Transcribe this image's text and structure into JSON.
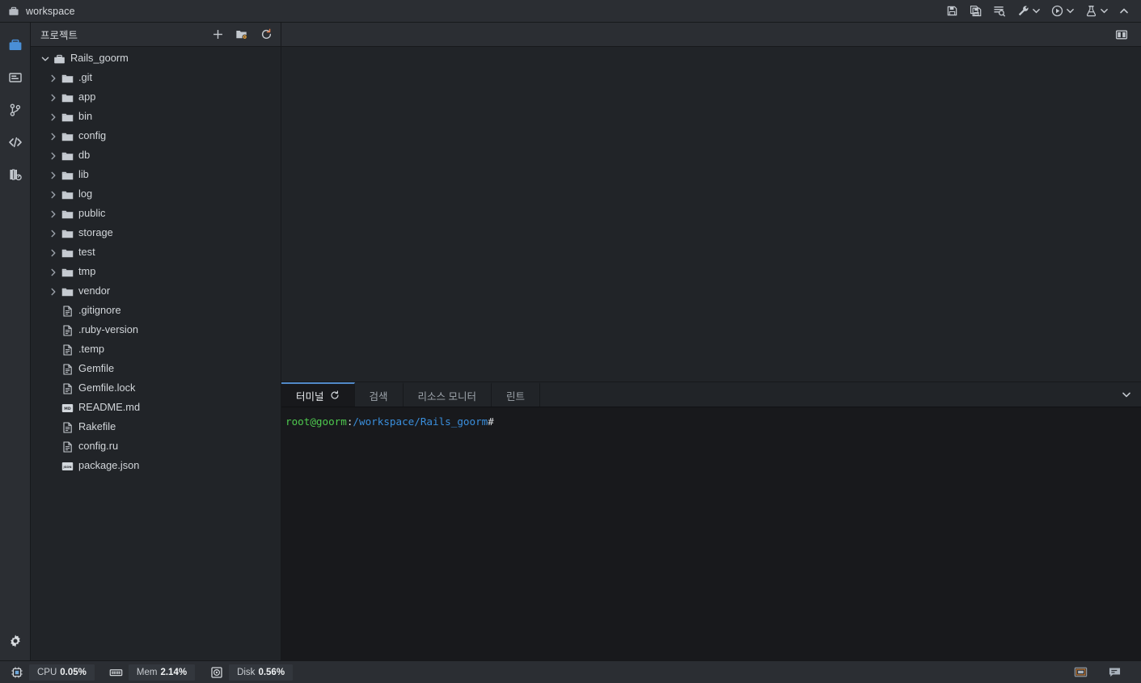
{
  "titlebar": {
    "workspace_icon": "briefcase-icon",
    "title": "workspace",
    "actions": [
      {
        "name": "save-button",
        "icon": "save-icon",
        "label": "저장"
      },
      {
        "name": "save-all-button",
        "icon": "save-all-icon",
        "label": "모두 저장"
      },
      {
        "name": "find-in-files-button",
        "icon": "find-in-files-icon",
        "label": "파일에서 찾기"
      },
      {
        "name": "tools-button",
        "icon": "wrench-icon",
        "label": "도구"
      },
      {
        "name": "run-button",
        "icon": "play-circle-icon",
        "label": "실행"
      },
      {
        "name": "test-button",
        "icon": "flask-icon",
        "label": "테스트"
      },
      {
        "name": "collapse-toolbar-button",
        "icon": "chevron-up-icon",
        "label": "접기"
      }
    ]
  },
  "rail": {
    "items": [
      {
        "name": "rail-item-project",
        "icon": "briefcase-icon",
        "label": "프로젝트",
        "active": true
      },
      {
        "name": "rail-item-panel",
        "icon": "window-icon",
        "label": "패널"
      },
      {
        "name": "rail-item-git",
        "icon": "git-branch-icon",
        "label": "Git"
      },
      {
        "name": "rail-item-code",
        "icon": "code-icon",
        "label": "코드"
      },
      {
        "name": "rail-item-library",
        "icon": "library-icon",
        "label": "라이브러리"
      }
    ],
    "bottom": {
      "name": "rail-item-settings",
      "icon": "gear-icon",
      "label": "설정"
    }
  },
  "project_panel": {
    "title": "프로젝트",
    "actions": [
      {
        "name": "new-file-button",
        "icon": "plus-icon",
        "label": "새로 만들기"
      },
      {
        "name": "folder-settings-button",
        "icon": "folder-gear-icon",
        "label": "폴더 설정"
      },
      {
        "name": "refresh-tree-button",
        "icon": "refresh-icon",
        "label": "새로고침"
      }
    ],
    "tree": [
      {
        "name": "tree-root-rails-goorm",
        "label": "Rails_goorm",
        "type": "root",
        "icon": "briefcase-icon",
        "depth": 0,
        "expanded": true
      },
      {
        "name": "tree-folder-git",
        "label": ".git",
        "type": "folder",
        "icon": "folder-icon",
        "depth": 1,
        "expanded": false
      },
      {
        "name": "tree-folder-app",
        "label": "app",
        "type": "folder",
        "icon": "folder-icon",
        "depth": 1,
        "expanded": false
      },
      {
        "name": "tree-folder-bin",
        "label": "bin",
        "type": "folder",
        "icon": "folder-icon",
        "depth": 1,
        "expanded": false
      },
      {
        "name": "tree-folder-config",
        "label": "config",
        "type": "folder",
        "icon": "folder-icon",
        "depth": 1,
        "expanded": false
      },
      {
        "name": "tree-folder-db",
        "label": "db",
        "type": "folder",
        "icon": "folder-icon",
        "depth": 1,
        "expanded": false
      },
      {
        "name": "tree-folder-lib",
        "label": "lib",
        "type": "folder",
        "icon": "folder-icon",
        "depth": 1,
        "expanded": false
      },
      {
        "name": "tree-folder-log",
        "label": "log",
        "type": "folder",
        "icon": "folder-icon",
        "depth": 1,
        "expanded": false
      },
      {
        "name": "tree-folder-public",
        "label": "public",
        "type": "folder",
        "icon": "folder-icon",
        "depth": 1,
        "expanded": false
      },
      {
        "name": "tree-folder-storage",
        "label": "storage",
        "type": "folder",
        "icon": "folder-icon",
        "depth": 1,
        "expanded": false
      },
      {
        "name": "tree-folder-test",
        "label": "test",
        "type": "folder",
        "icon": "folder-icon",
        "depth": 1,
        "expanded": false
      },
      {
        "name": "tree-folder-tmp",
        "label": "tmp",
        "type": "folder",
        "icon": "folder-icon",
        "depth": 1,
        "expanded": false
      },
      {
        "name": "tree-folder-vendor",
        "label": "vendor",
        "type": "folder",
        "icon": "folder-icon",
        "depth": 1,
        "expanded": false
      },
      {
        "name": "tree-file-gitignore",
        "label": ".gitignore",
        "type": "file",
        "icon": "file-icon",
        "depth": 1
      },
      {
        "name": "tree-file-ruby-version",
        "label": ".ruby-version",
        "type": "file",
        "icon": "file-icon",
        "depth": 1
      },
      {
        "name": "tree-file-temp",
        "label": ".temp",
        "type": "file",
        "icon": "file-icon",
        "depth": 1
      },
      {
        "name": "tree-file-gemfile",
        "label": "Gemfile",
        "type": "file",
        "icon": "file-icon",
        "depth": 1
      },
      {
        "name": "tree-file-gemfile-lock",
        "label": "Gemfile.lock",
        "type": "file",
        "icon": "file-icon",
        "depth": 1
      },
      {
        "name": "tree-file-readme-md",
        "label": "README.md",
        "type": "file",
        "icon": "markdown-file-icon",
        "badge": "MD",
        "depth": 1
      },
      {
        "name": "tree-file-rakefile",
        "label": "Rakefile",
        "type": "file",
        "icon": "file-icon",
        "depth": 1
      },
      {
        "name": "tree-file-config-ru",
        "label": "config.ru",
        "type": "file",
        "icon": "file-icon",
        "depth": 1
      },
      {
        "name": "tree-file-package-json",
        "label": "package.json",
        "type": "file",
        "icon": "json-file-icon",
        "badge": "JSON",
        "depth": 1
      }
    ]
  },
  "editor": {
    "split_button": {
      "name": "split-editor-button",
      "icon": "split-editor-icon",
      "label": "편집기 분할"
    },
    "content": ""
  },
  "dock": {
    "tabs": [
      {
        "name": "tab-terminal",
        "label": "터미널",
        "icon": "refresh-icon",
        "active": true
      },
      {
        "name": "tab-search",
        "label": "검색",
        "active": false
      },
      {
        "name": "tab-resource-monitor",
        "label": "리소스 모니터",
        "active": false
      },
      {
        "name": "tab-lint",
        "label": "린트",
        "active": false
      }
    ],
    "collapse_button": {
      "name": "dock-collapse-button",
      "icon": "chevron-down-icon"
    },
    "terminal": {
      "prompt_user": "root@goorm",
      "prompt_colon": ":",
      "prompt_path": "/workspace/Rails_goorm",
      "prompt_symbol": "#",
      "full_line": "root@goorm:/workspace/Rails_goorm#"
    }
  },
  "status_bar": {
    "metrics": [
      {
        "name": "status-cpu",
        "icon": "cpu-icon",
        "label": "CPU",
        "value": "0.05%"
      },
      {
        "name": "status-mem",
        "icon": "ram-icon",
        "label": "Mem",
        "value": "2.14%"
      },
      {
        "name": "status-disk",
        "icon": "disk-icon",
        "label": "Disk",
        "value": "0.56%"
      }
    ],
    "right_actions": [
      {
        "name": "toggle-panel-button",
        "icon": "panel-layout-icon"
      },
      {
        "name": "toggle-chat-button",
        "icon": "chat-icon"
      }
    ]
  },
  "colors": {
    "accent": "#5289c8",
    "titlebar_bg": "#2b2e33",
    "panel_bg": "#212428",
    "terminal_bg": "#18191c",
    "folder_icon": "#c6cbd1",
    "prompt_user": "#4ec94e",
    "prompt_path": "#3a8fdd",
    "rail_active": "#4a8fd6"
  }
}
